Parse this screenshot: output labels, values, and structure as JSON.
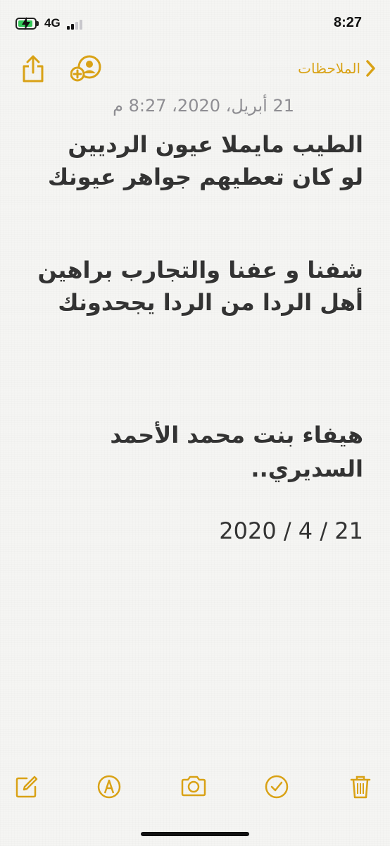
{
  "status_bar": {
    "network": "4G",
    "time": "8:27",
    "battery_level": 0.92,
    "battery_color": "#34c759",
    "signal_bars": 2,
    "signal_total": 4
  },
  "nav": {
    "back_label": "الملاحظات",
    "share_icon": "share-icon",
    "add_person_icon": "add-person-icon",
    "accent": "#d9a216"
  },
  "note": {
    "date": "21 أبريل، 2020، 8:27 م",
    "lines": [
      "الطيب  مايملا  عيون  الرديين",
      "لو  كان  تعطيهم جواهر عيونك",
      "شفنا و عفنا  والتجارب براهين",
      "أهل الردا  من  الردا  يجحدونك",
      "هيفاء بنت محمد الأحمد",
      "السديري..",
      "2020 / 4 / 21"
    ]
  },
  "toolbar": {
    "icons": [
      "compose-icon",
      "markup-icon",
      "camera-icon",
      "checklist-icon",
      "trash-icon"
    ]
  }
}
